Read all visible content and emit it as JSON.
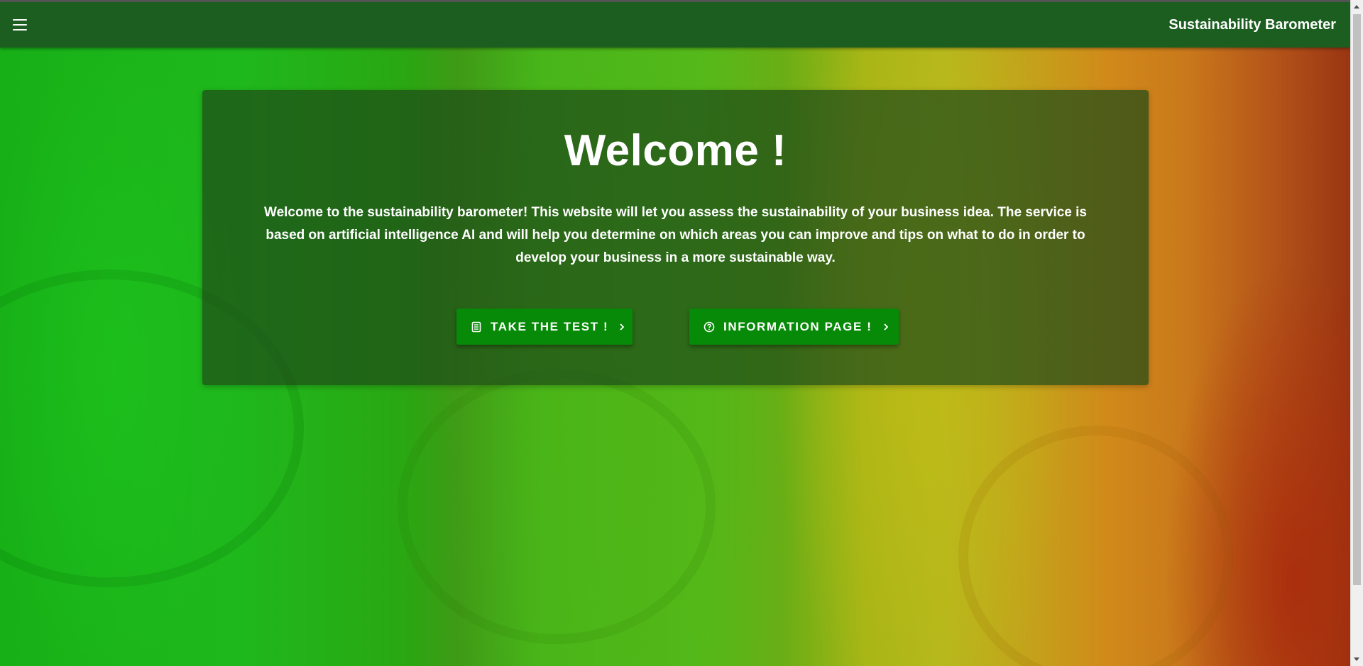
{
  "appbar": {
    "title": "Sustainability Barometer",
    "menu_icon": "menu-icon"
  },
  "hero": {
    "heading": "Welcome !",
    "description": "Welcome to the sustainability barometer! This website will let you assess the sustainability of your business idea. The service is based on artificial intelligence AI and will help you determine on which areas you can improve and tips on what to do in order to develop your business in a more sustainable way.",
    "buttons": [
      {
        "label": "TAKE THE TEST !",
        "icon": "list-document-icon",
        "trailing_icon": "chevron-right-icon"
      },
      {
        "label": "INFORMATION PAGE !",
        "icon": "help-circle-icon",
        "trailing_icon": "chevron-right-icon"
      }
    ]
  },
  "colors": {
    "appbar": "#1b5e20",
    "button": "#078a07",
    "card_overlay": "rgba(30,75,25,0.72)"
  }
}
